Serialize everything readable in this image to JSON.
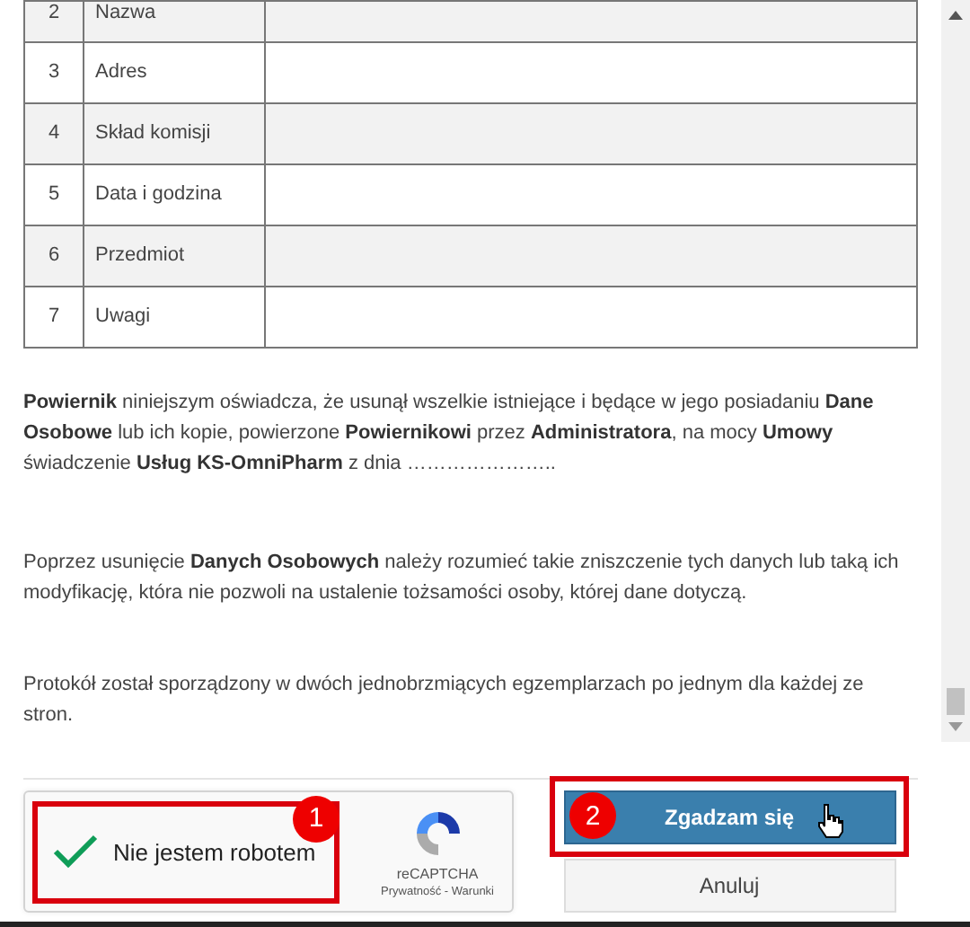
{
  "table": {
    "rows": [
      {
        "number": "2",
        "label": "Nazwa"
      },
      {
        "number": "3",
        "label": "Adres"
      },
      {
        "number": "4",
        "label": "Skład komisji"
      },
      {
        "number": "5",
        "label": "Data i godzina"
      },
      {
        "number": "6",
        "label": "Przedmiot"
      },
      {
        "number": "7",
        "label": "Uwagi"
      }
    ]
  },
  "paragraphs": [
    "**Powiernik** niniejszym oświadcza, że usunął wszelkie istniejące i będące w jego posiadaniu **Dane Osobowe** lub ich kopie, powierzone **Powiernikowi** przez **Administratora**, na mocy **Umowy** świadczenie **Usług KS-OmniPharm** z dnia …………………..",
    "Poprzez usunięcie **Danych Osobowych** należy rozumieć takie zniszczenie tych danych lub taką ich modyfikację, która nie pozwoli na ustalenie tożsamości osoby, której dane dotyczą.",
    "Protokół został sporządzony w dwóch jednobrzmiących egzemplarzach po jednym dla każdej ze stron."
  ],
  "captcha": {
    "checked": true,
    "label": "Nie jestem robotem",
    "brand": "reCAPTCHA",
    "links": "Prywatność - Warunki",
    "annotation": "1"
  },
  "buttons": [
    {
      "label": "Zgadzam się",
      "kind": "primary",
      "annotation": "2"
    },
    {
      "label": "Anuluj",
      "kind": "secondary"
    }
  ]
}
